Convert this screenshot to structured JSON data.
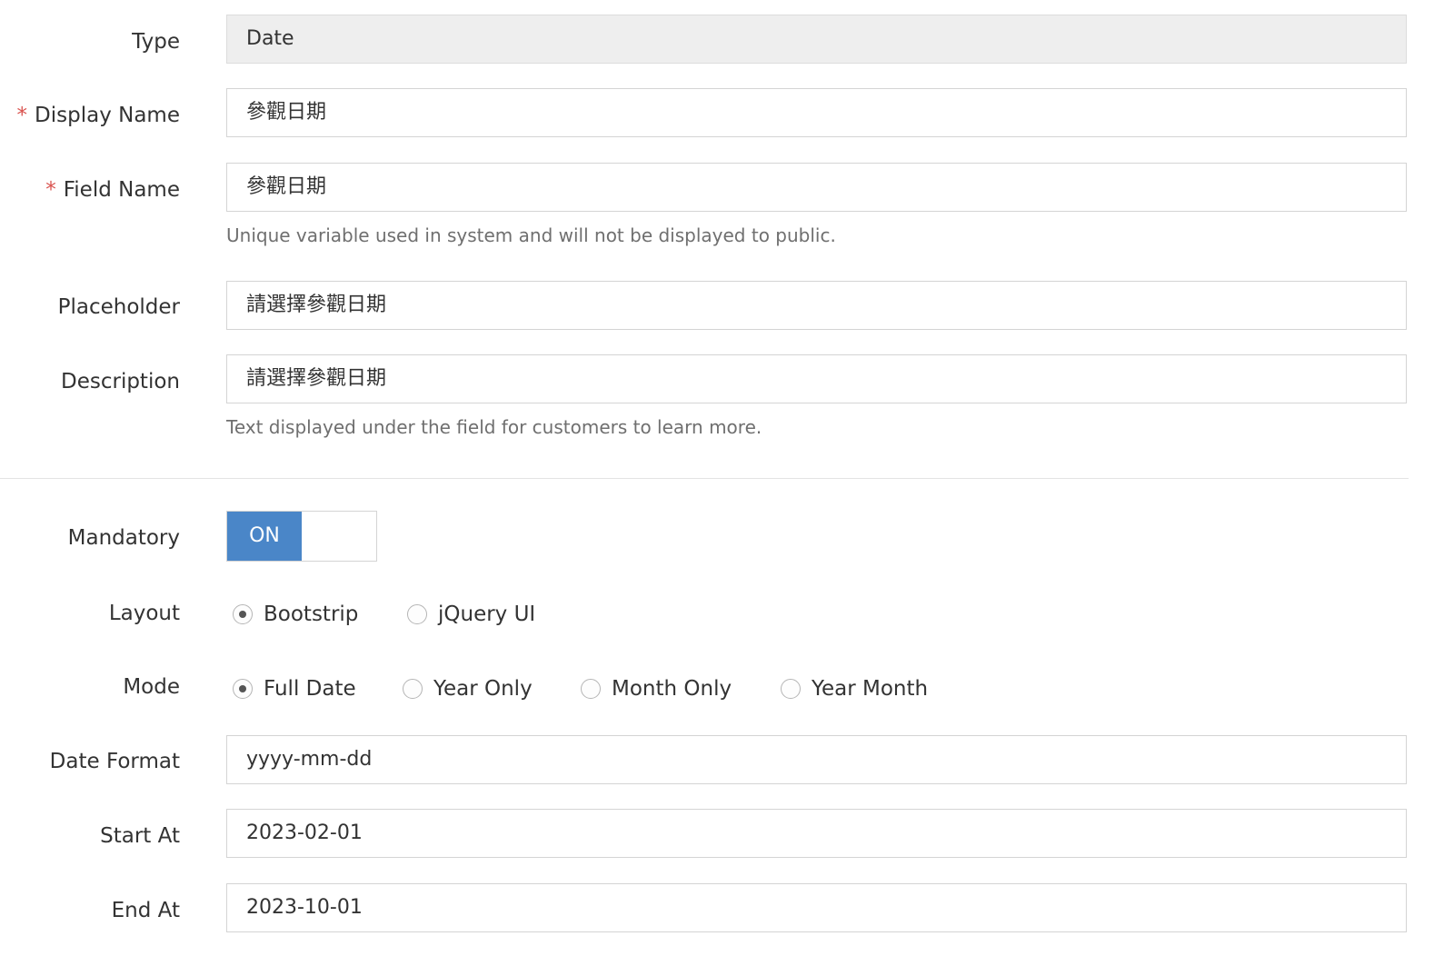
{
  "form": {
    "type": {
      "label": "Type",
      "value": "Date"
    },
    "display_name": {
      "required_mark": "*",
      "label": "Display Name",
      "value": "參觀日期"
    },
    "field_name": {
      "required_mark": "*",
      "label": "Field Name",
      "value": "參觀日期",
      "help": "Unique variable used in system and will not be displayed to public."
    },
    "placeholder": {
      "label": "Placeholder",
      "value": "請選擇參觀日期"
    },
    "description": {
      "label": "Description",
      "value": "請選擇參觀日期",
      "help": "Text displayed under the field for customers to learn more."
    },
    "mandatory": {
      "label": "Mandatory",
      "toggle_label": "ON",
      "on": true
    },
    "layout": {
      "label": "Layout",
      "options": [
        "Bootstrip",
        "jQuery UI"
      ],
      "selected": "Bootstrip"
    },
    "mode": {
      "label": "Mode",
      "options": [
        "Full Date",
        "Year Only",
        "Month Only",
        "Year Month"
      ],
      "selected": "Full Date"
    },
    "date_format": {
      "label": "Date Format",
      "value": "yyyy-mm-dd"
    },
    "start_at": {
      "label": "Start At",
      "value": "2023-02-01"
    },
    "end_at": {
      "label": "End At",
      "value": "2023-10-01"
    }
  },
  "colors": {
    "accent": "#4a86c8",
    "required": "#d9534f",
    "readonly_bg": "#eeeeee",
    "border": "#d4d4d4"
  }
}
